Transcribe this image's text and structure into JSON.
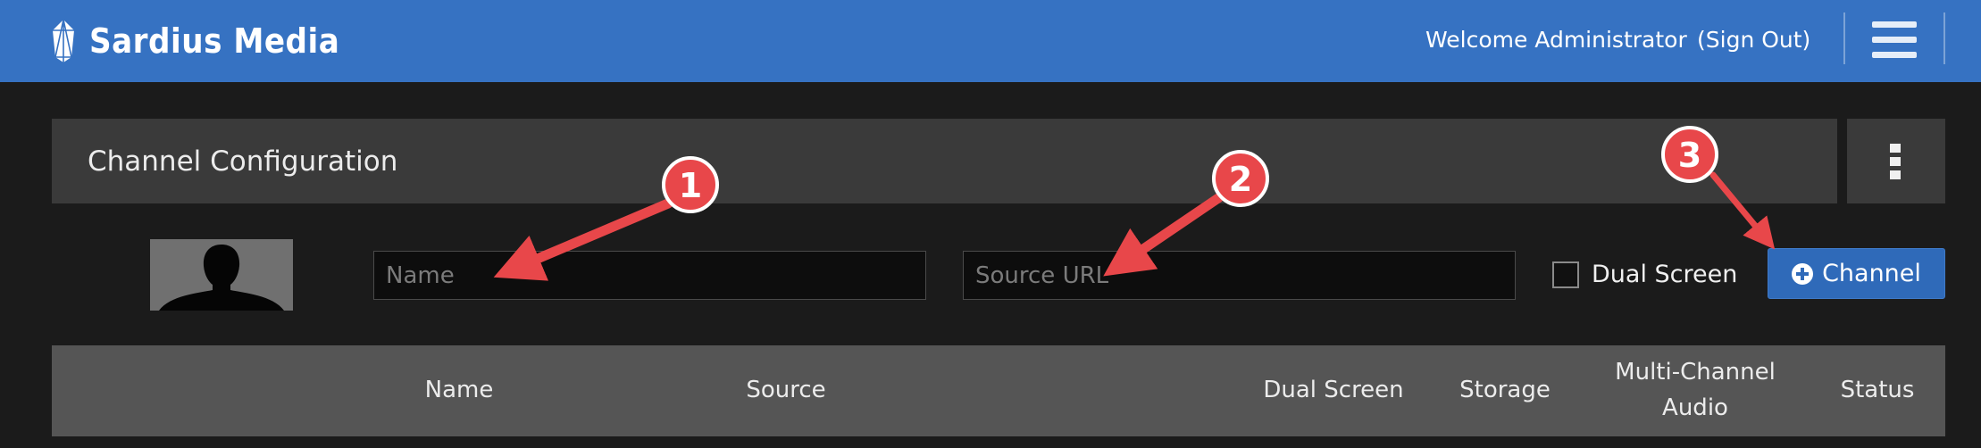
{
  "header": {
    "brand": "Sardius Media",
    "welcome": "Welcome Administrator",
    "sign_out": "(Sign Out)",
    "color": "#3672c2"
  },
  "panel": {
    "title": "Channel Configuration"
  },
  "form": {
    "name_placeholder": "Name",
    "name_value": "",
    "source_placeholder": "Source URL",
    "source_value": "",
    "dual_screen_label": "Dual Screen",
    "dual_screen_checked": false,
    "add_button_label": "Channel"
  },
  "table": {
    "columns": [
      "Name",
      "Source",
      "Dual Screen",
      "Storage",
      "Multi-Channel\nAudio",
      "Status"
    ]
  },
  "annotations": {
    "badges": [
      "1",
      "2",
      "3"
    ],
    "color": "#e8474a"
  }
}
